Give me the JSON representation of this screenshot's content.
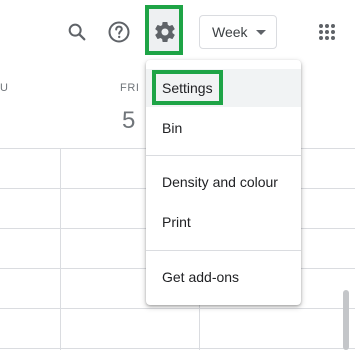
{
  "toolbar": {
    "view_select": "Week",
    "icons": [
      "search-icon",
      "help-icon",
      "gear-icon",
      "apps-grid-icon"
    ]
  },
  "calendar": {
    "partial_day_label": "U",
    "days": [
      {
        "name": "FRI",
        "number": "5"
      }
    ]
  },
  "settings_menu": {
    "items": [
      {
        "label": "Settings"
      },
      {
        "label": "Bin"
      },
      {
        "label": "Density and colour"
      },
      {
        "label": "Print"
      },
      {
        "label": "Get add-ons"
      }
    ]
  },
  "colors": {
    "highlight": "#1ea446",
    "icon": "#5f6368",
    "divider": "#dadce0"
  }
}
